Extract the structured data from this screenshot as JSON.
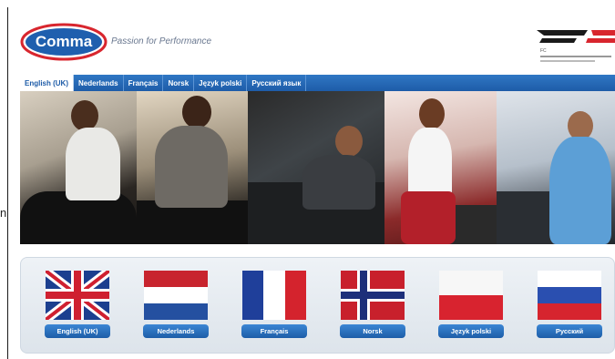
{
  "brand": {
    "logo_text": "Comma",
    "tagline": "Passion for Performance",
    "partner_logo": "FC"
  },
  "lang_tabs": [
    {
      "label": "English (UK)",
      "active": true
    },
    {
      "label": "Nederlands",
      "active": false
    },
    {
      "label": "Français",
      "active": false
    },
    {
      "label": "Norsk",
      "active": false
    },
    {
      "label": "Język polski",
      "active": false
    },
    {
      "label": "Русский язык",
      "active": false
    }
  ],
  "flags": [
    {
      "label": "English (UK)",
      "icon": "uk-flag-icon"
    },
    {
      "label": "Nederlands",
      "icon": "netherlands-flag-icon"
    },
    {
      "label": "Français",
      "icon": "france-flag-icon"
    },
    {
      "label": "Norsk",
      "icon": "norway-flag-icon"
    },
    {
      "label": "Język polski",
      "icon": "poland-flag-icon"
    },
    {
      "label": "Русский",
      "icon": "russia-flag-icon"
    }
  ],
  "edge_mark": "n",
  "colors": {
    "nav_blue": "#1e5ca8",
    "brand_blue": "#1f5fae",
    "brand_red": "#d8262e"
  }
}
